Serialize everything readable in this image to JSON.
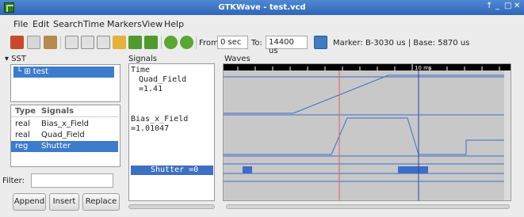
{
  "window": {
    "title": "GTKWave - test.vcd",
    "controls": [
      "↑",
      "_",
      "□",
      "✕"
    ]
  },
  "menu": [
    "File",
    "Edit",
    "Search",
    "Time",
    "Markers",
    "View",
    "Help"
  ],
  "toolbar": {
    "from_label": "From:",
    "from_value": "0 sec",
    "to_label": "To:",
    "to_value": "14400 us",
    "status": "Marker: B-3030 us  |  Base: 5870 us"
  },
  "sst": {
    "label": "SST",
    "tree_item": "test"
  },
  "signal_list": {
    "col_type": "Type",
    "col_signals": "Signals",
    "rows": [
      {
        "type": "real",
        "name": "Bias_x_Field"
      },
      {
        "type": "real",
        "name": "Quad_Field"
      },
      {
        "type": "reg",
        "name": "Shutter"
      }
    ],
    "selected_index": 2
  },
  "filter_label": "Filter:",
  "buttons": {
    "append": "Append",
    "insert": "Insert",
    "replace": "Replace"
  },
  "signals_pane": {
    "label": "Signals",
    "header": "Time",
    "rows": [
      "Quad_Field =1.41",
      "Bias_x_Field =1.01047",
      "Shutter =0"
    ]
  },
  "waves_pane": {
    "label": "Waves",
    "time_marker_label": "10 ms"
  },
  "colors": {
    "wave_bg": "#c8c8c8",
    "wave_line": "#3c6ec8",
    "primary_marker": "#e06060",
    "base_marker": "#2b46a0",
    "selection": "#3d7ccc"
  }
}
